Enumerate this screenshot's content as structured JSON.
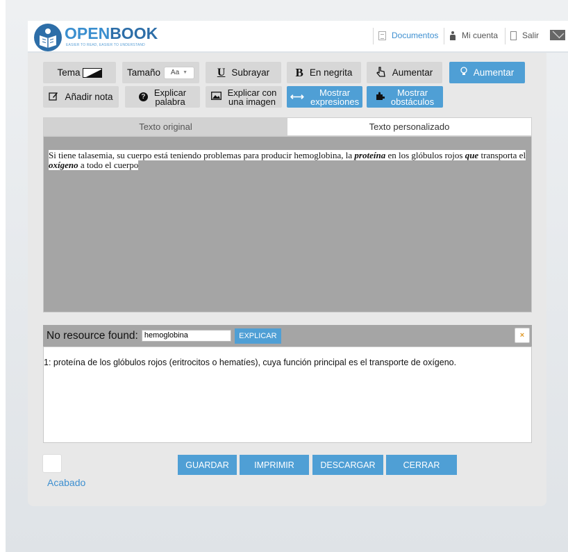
{
  "brand": {
    "name_open": "OPEN",
    "name_book": "BOOK",
    "tagline": "EASIER TO READ, EASIER TO UNDERSTAND"
  },
  "nav": {
    "documents": "Documentos",
    "account": "Mi cuenta",
    "exit": "Salir"
  },
  "toolbar": {
    "theme": "Tema",
    "size": "Tamaño",
    "size_value": "Aa",
    "underline": "Subrayar",
    "bold": "En negrita",
    "increase_1": "Aumentar",
    "increase_2": "Aumentar",
    "add_note": "Añadir nota",
    "explain_word_1": "Explicar",
    "explain_word_2": "palabra",
    "explain_image_1": "Explicar con",
    "explain_image_2": "una imagen",
    "show_expr_1": "Mostrar",
    "show_expr_2": "expresiones",
    "show_obst_1": "Mostrar",
    "show_obst_2": "obstáculos"
  },
  "tabs": {
    "original": "Texto original",
    "custom": "Texto personalizado"
  },
  "text": {
    "p1": "Si tiene talasemia, su cuerpo está teniendo problemas para producir hemoglobina, la ",
    "b1": "proteína",
    "p2": " en los glóbulos rojos ",
    "b2": "que",
    "p3": " transporta el ",
    "b3": "oxígeno",
    "p4": " a todo el cuerpo "
  },
  "definition": {
    "label": "No resource found:",
    "word": "hemoglobina",
    "explain_button": "EXPLICAR",
    "close": "×",
    "body": "1: proteína de los glóbulos rojos (eritrocitos o hematíes), cuya función principal es el transporte de oxígeno."
  },
  "footer": {
    "done": "Acabado",
    "save": "GUARDAR",
    "print": "IMPRIMIR",
    "download": "DESCARGAR",
    "close": "CERRAR"
  },
  "colors": {
    "accent": "#4f9fd5",
    "brand": "#2d6ea8"
  }
}
